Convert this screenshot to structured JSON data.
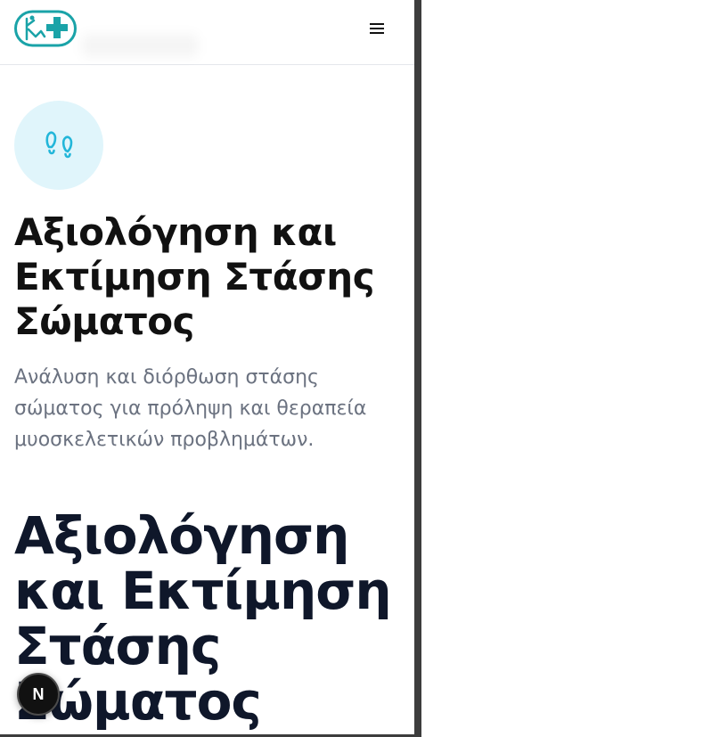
{
  "header": {
    "logo_icon": "physio-cross-logo-icon",
    "menu_icon": "hamburger-menu-icon",
    "menu_glyph": "≡"
  },
  "hero": {
    "icon": "footprints-icon",
    "title": "Αξιολόγηση και Εκτίμηση Στάσης Σώματος",
    "subtitle": "Ανάλυση και διόρθωση στάσης σώματος για πρόληψη και θεραπεία μυοσκελετικών προβλημάτων."
  },
  "article": {
    "title": "Αξιολόγηση και Εκτίμηση Στάσης Σώματος"
  },
  "dev_badge": {
    "label": "N"
  },
  "colors": {
    "accent": "#1aa3a8",
    "icon_blue": "#22b6d9",
    "icon_bg": "#e0f5fb",
    "subtitle": "#6b7280"
  }
}
